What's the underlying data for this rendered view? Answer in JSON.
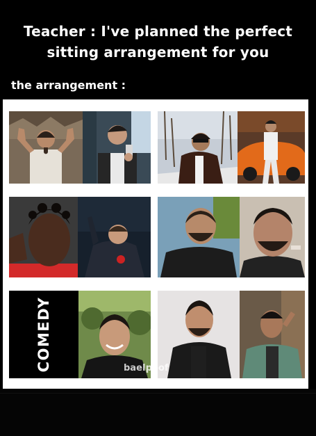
{
  "caption": {
    "line1": "Teacher : I've planned the perfect",
    "line2": "sitting arrangement for you"
  },
  "subheading": "the arrangement :",
  "grid": {
    "comedy_label": "COMEDY",
    "watermark": "baeIpoof"
  },
  "colors": {
    "background": "#000000",
    "panel": "#ffffff",
    "text": "#ffffff"
  }
}
